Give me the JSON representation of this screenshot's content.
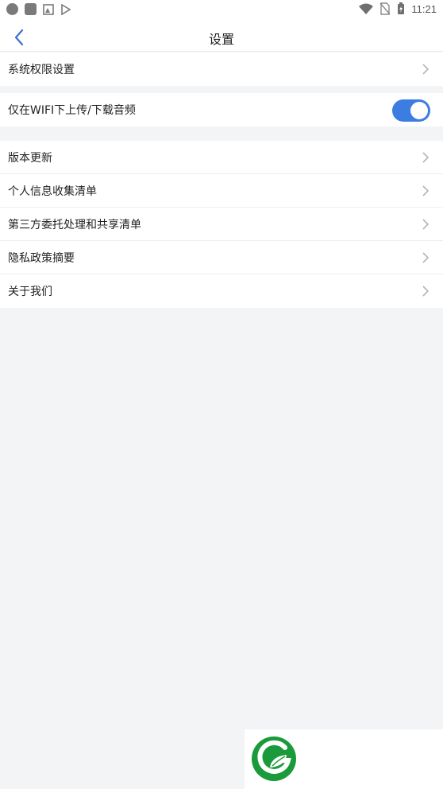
{
  "status_bar": {
    "time": "11:21",
    "left_icons": [
      "circle-notification-icon",
      "square-notification-icon",
      "photo-notification-icon",
      "play-store-icon"
    ],
    "right_icons": [
      "wifi-icon",
      "no-sim-icon",
      "battery-charging-icon"
    ]
  },
  "header": {
    "title": "设置",
    "back_icon": "chevron-left-icon"
  },
  "group1": {
    "items": [
      {
        "label": "系统权限设置"
      }
    ]
  },
  "group2": {
    "wifi_only": {
      "label": "仅在WIFI下上传/下载音频",
      "enabled": true
    }
  },
  "group3": {
    "items": [
      {
        "label": "版本更新"
      },
      {
        "label": "个人信息收集清单"
      },
      {
        "label": "第三方委托处理和共享清单"
      },
      {
        "label": "隐私政策摘要"
      },
      {
        "label": "关于我们"
      }
    ]
  },
  "colors": {
    "accent": "#3b7de0",
    "background": "#f3f4f6",
    "logo_green": "#1a9a3a"
  }
}
